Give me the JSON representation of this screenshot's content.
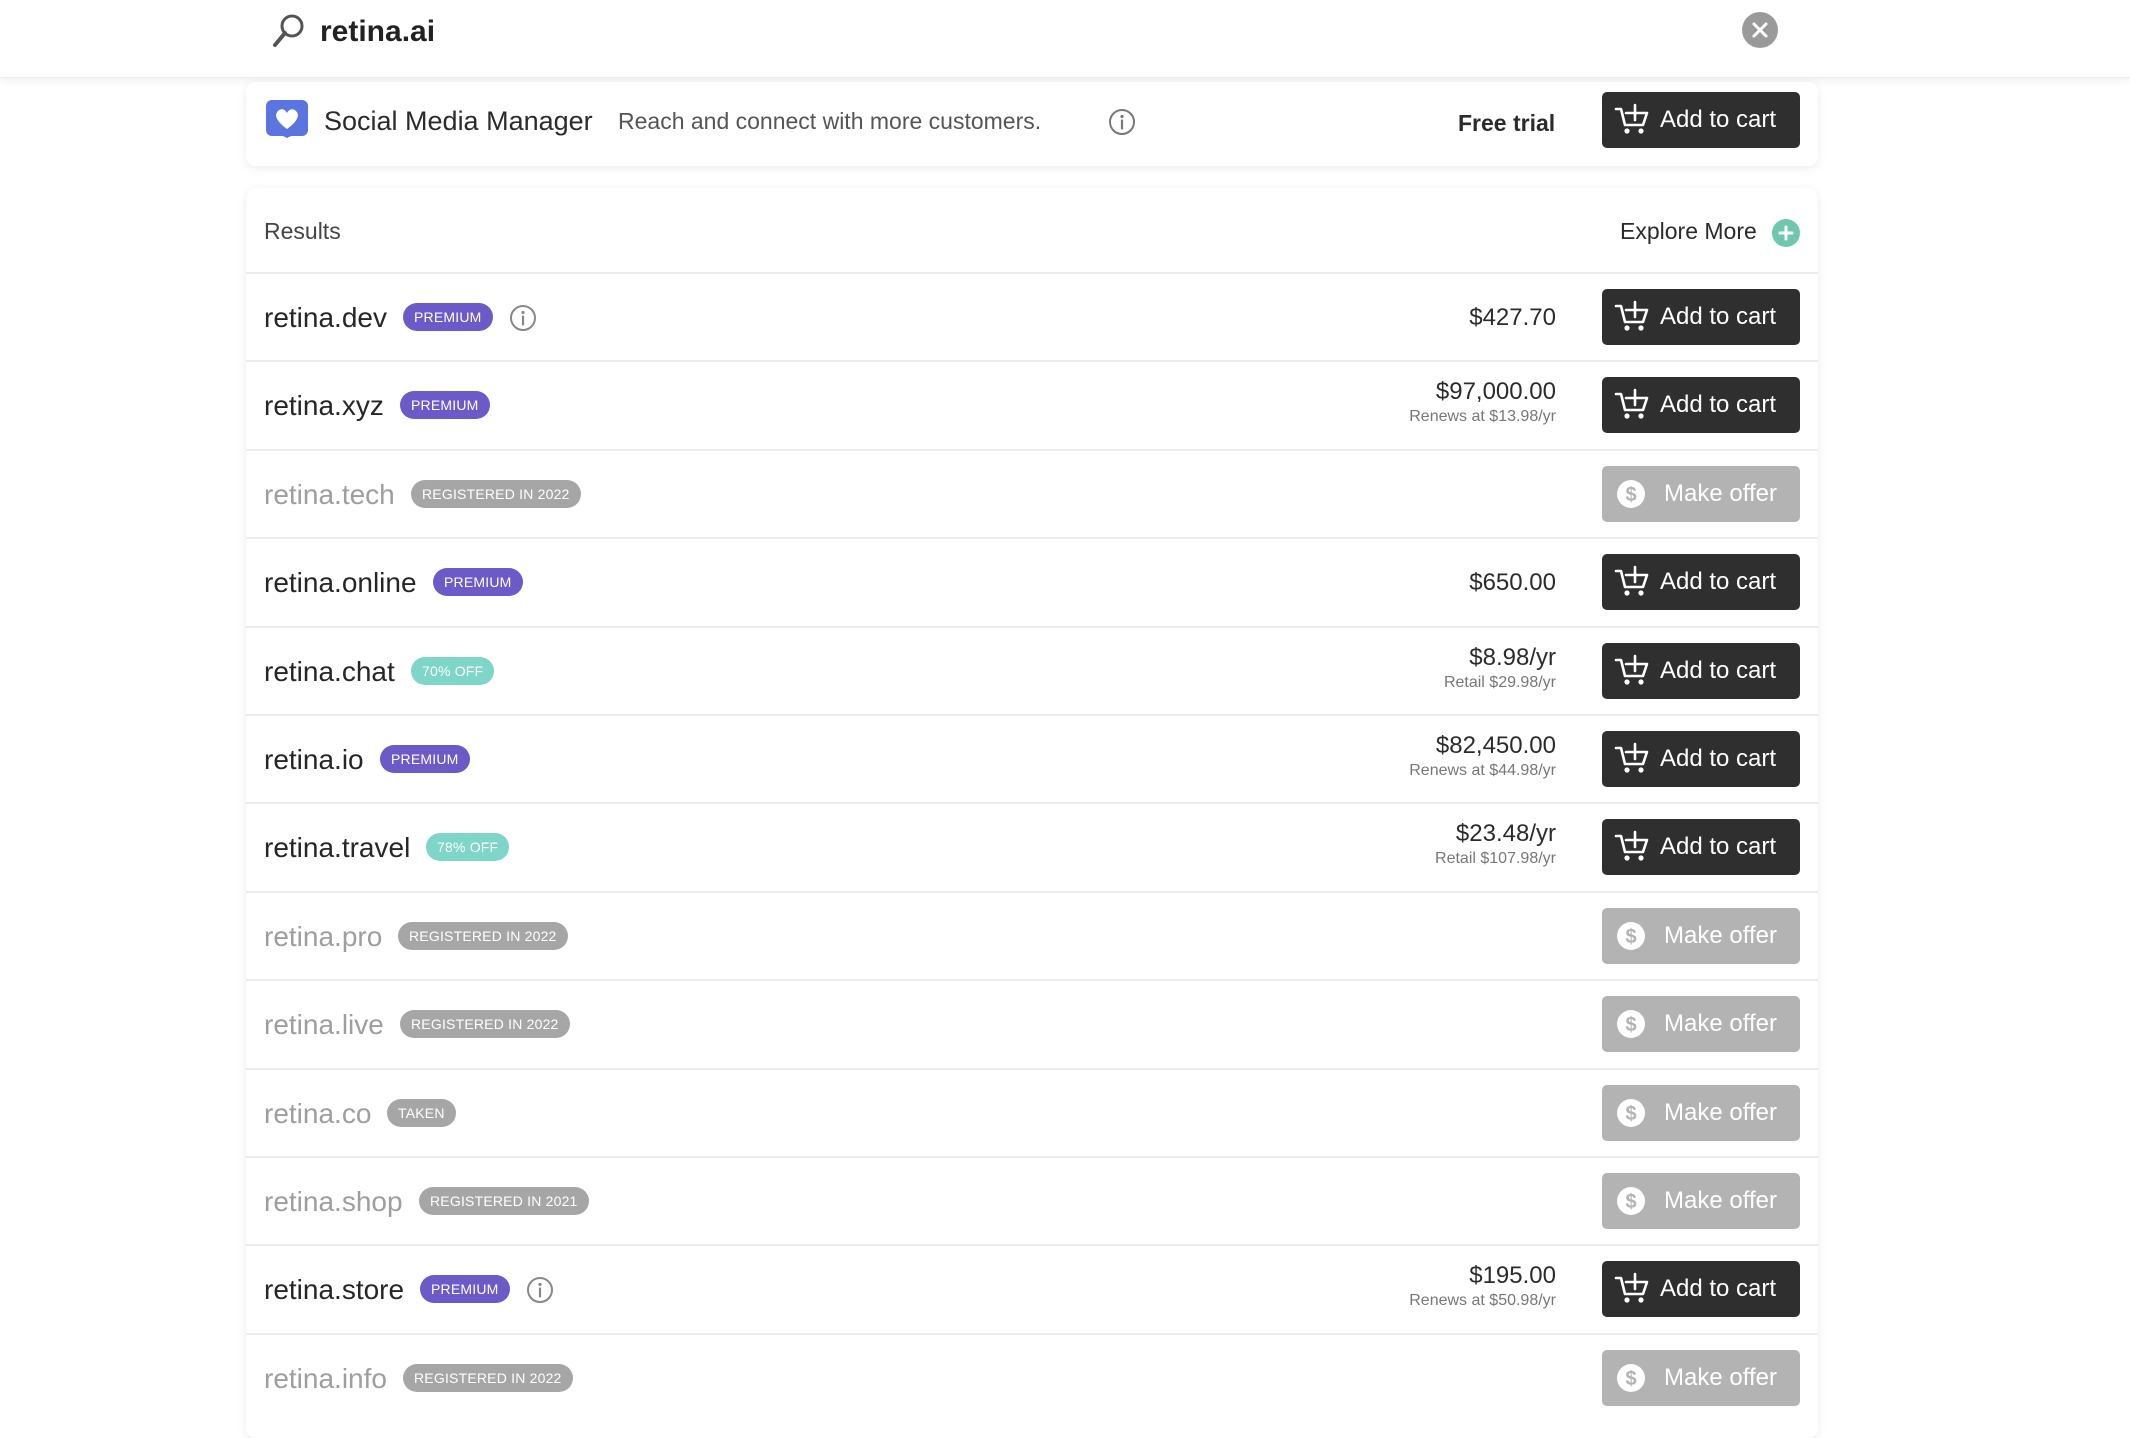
{
  "search": {
    "query": "retina.ai"
  },
  "promo": {
    "title": "Social Media Manager",
    "description": "Reach and connect with more customers.",
    "price": "Free trial",
    "button_label": "Add to cart"
  },
  "results": {
    "title": "Results",
    "explore_label": "Explore More",
    "rows": [
      {
        "name": "retina.dev",
        "badge": "PREMIUM",
        "badge_type": "premium",
        "price": "$427.70",
        "sub": "",
        "action": "Add to cart",
        "available": true,
        "info": true
      },
      {
        "name": "retina.xyz",
        "badge": "PREMIUM",
        "badge_type": "premium",
        "price": "$97,000.00",
        "sub": "Renews at $13.98/yr",
        "action": "Add to cart",
        "available": true,
        "info": false
      },
      {
        "name": "retina.tech",
        "badge": "REGISTERED IN 2022",
        "badge_type": "reg",
        "price": "",
        "sub": "",
        "action": "Make offer",
        "available": false,
        "info": false
      },
      {
        "name": "retina.online",
        "badge": "PREMIUM",
        "badge_type": "premium",
        "price": "$650.00",
        "sub": "",
        "action": "Add to cart",
        "available": true,
        "info": false
      },
      {
        "name": "retina.chat",
        "badge": "70% OFF",
        "badge_type": "off",
        "price": "$8.98/yr",
        "sub": "Retail $29.98/yr",
        "action": "Add to cart",
        "available": true,
        "info": false
      },
      {
        "name": "retina.io",
        "badge": "PREMIUM",
        "badge_type": "premium",
        "price": "$82,450.00",
        "sub": "Renews at $44.98/yr",
        "action": "Add to cart",
        "available": true,
        "info": false
      },
      {
        "name": "retina.travel",
        "badge": "78% OFF",
        "badge_type": "off",
        "price": "$23.48/yr",
        "sub": "Retail $107.98/yr",
        "action": "Add to cart",
        "available": true,
        "info": false
      },
      {
        "name": "retina.pro",
        "badge": "REGISTERED IN 2022",
        "badge_type": "reg",
        "price": "",
        "sub": "",
        "action": "Make offer",
        "available": false,
        "info": false
      },
      {
        "name": "retina.live",
        "badge": "REGISTERED IN 2022",
        "badge_type": "reg",
        "price": "",
        "sub": "",
        "action": "Make offer",
        "available": false,
        "info": false
      },
      {
        "name": "retina.co",
        "badge": "TAKEN",
        "badge_type": "reg",
        "price": "",
        "sub": "",
        "action": "Make offer",
        "available": false,
        "info": false
      },
      {
        "name": "retina.shop",
        "badge": "REGISTERED IN 2021",
        "badge_type": "reg",
        "price": "",
        "sub": "",
        "action": "Make offer",
        "available": false,
        "info": false
      },
      {
        "name": "retina.store",
        "badge": "PREMIUM",
        "badge_type": "premium",
        "price": "$195.00",
        "sub": "Renews at $50.98/yr",
        "action": "Add to cart",
        "available": true,
        "info": true
      },
      {
        "name": "retina.info",
        "badge": "REGISTERED IN 2022",
        "badge_type": "reg",
        "price": "",
        "sub": "",
        "action": "Make offer",
        "available": false,
        "info": false
      }
    ]
  },
  "colors": {
    "premium_badge": "#6b5ac8",
    "discount_badge": "#7dd6c7",
    "registered_badge": "#a6a6a6",
    "cart_button": "#2f2f2f",
    "offer_button": "#b3b3b3",
    "explore_plus": "#6fc7ae",
    "heart_icon": "#5a74e0"
  },
  "icons": {
    "search": "magnifier-icon",
    "clear": "close-icon",
    "promo": "heart-icon",
    "info": "info-icon",
    "cart": "cart-plus-icon",
    "offer": "dollar-icon",
    "explore": "plus-icon"
  }
}
